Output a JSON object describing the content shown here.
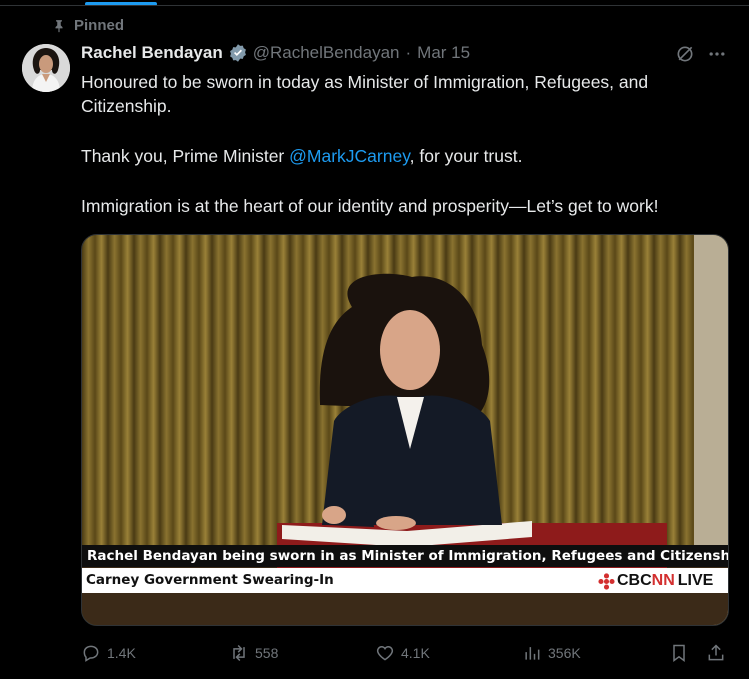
{
  "pinned_label": "Pinned",
  "author": {
    "name": "Rachel Bendayan",
    "handle": "@RachelBendayan",
    "date": "Mar 15",
    "separator": "·"
  },
  "tweet": {
    "line1": "Honoured to be sworn in today as Minister of Immigration, Refugees, and Citizenship.",
    "thanks_prefix": "Thank you, Prime Minister ",
    "mention": "@MarkJCarney",
    "thanks_suffix": ", for your trust.",
    "line3": "Immigration is at the heart of our identity and prosperity—Let’s get to work!"
  },
  "media": {
    "caption_top": "Rachel Bendayan being sworn in as Minister of Immigration, Refugees and Citizenship",
    "caption_bottom": "Carney Government Swearing-In",
    "logo_cbc": "CBC",
    "logo_nn": "NN",
    "logo_live": "LIVE"
  },
  "actions": {
    "replies": "1.4K",
    "reposts": "558",
    "likes": "4.1K",
    "views": "356K"
  },
  "colors": {
    "accent": "#1d9bf0",
    "muted": "#71767b",
    "text": "#e7e9ea",
    "background": "#000000",
    "cbc_red": "#d32f2f"
  },
  "icons": [
    "pin-icon",
    "verified-badge-icon",
    "grok-icon",
    "more-icon",
    "reply-icon",
    "repost-icon",
    "like-icon",
    "views-icon",
    "bookmark-icon",
    "share-icon",
    "cbc-gem-icon"
  ]
}
